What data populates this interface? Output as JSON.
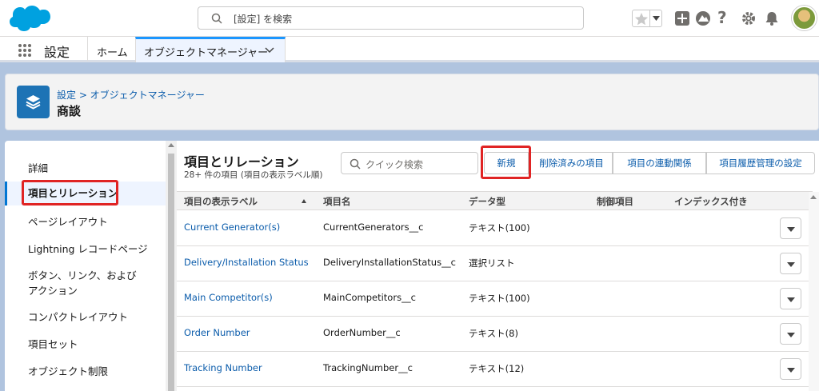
{
  "header": {
    "search_placeholder": "[設定] を検索",
    "icons": [
      "salesforce-cloud-logo",
      "star-icon",
      "chevron-down-icon",
      "plus-icon",
      "trailhead-icon",
      "help-icon",
      "gear-icon",
      "bell-icon",
      "avatar"
    ],
    "help_glyph": "?"
  },
  "nav": {
    "app_name": "設定",
    "home": "ホーム",
    "active_tab": "オブジェクトマネージャー"
  },
  "page": {
    "breadcrumb": "設定 > オブジェクトマネージャー",
    "title": "商談"
  },
  "sidebar": {
    "items": [
      {
        "label": "詳細"
      },
      {
        "label": "項目とリレーション"
      },
      {
        "label": "ページレイアウト"
      },
      {
        "label": "Lightning レコードページ"
      },
      {
        "label": "ボタン、リンク、および"
      },
      {
        "label": "アクション"
      },
      {
        "label": "コンパクトレイアウト"
      },
      {
        "label": "項目セット"
      },
      {
        "label": "オブジェクト制限"
      }
    ]
  },
  "main": {
    "title": "項目とリレーション",
    "subtitle": "28+ 件の項目 (項目の表示ラベル順)",
    "quick_search": "クイック検索",
    "buttons": {
      "new": "新規",
      "deleted": "削除済みの項目",
      "dependencies": "項目の連動関係",
      "history": "項目履歴管理の設定"
    },
    "columns": [
      "項目の表示ラベル",
      "項目名",
      "データ型",
      "制御項目",
      "インデックス付き"
    ],
    "rows": [
      {
        "label": "Current Generator(s)",
        "name": "CurrentGenerators__c",
        "type": "テキスト(100)"
      },
      {
        "label": "Delivery/Installation Status",
        "name": "DeliveryInstallationStatus__c",
        "type": "選択リスト"
      },
      {
        "label": "Main Competitor(s)",
        "name": "MainCompetitors__c",
        "type": "テキスト(100)"
      },
      {
        "label": "Order Number",
        "name": "OrderNumber__c",
        "type": "テキスト(8)"
      },
      {
        "label": "Tracking Number",
        "name": "TrackingNumber__c",
        "type": "テキスト(12)"
      }
    ]
  },
  "colors": {
    "accent": "#0176d3",
    "link": "#0b5cab",
    "highlight_box": "#e02424",
    "page_icon": "#1d73b5"
  }
}
